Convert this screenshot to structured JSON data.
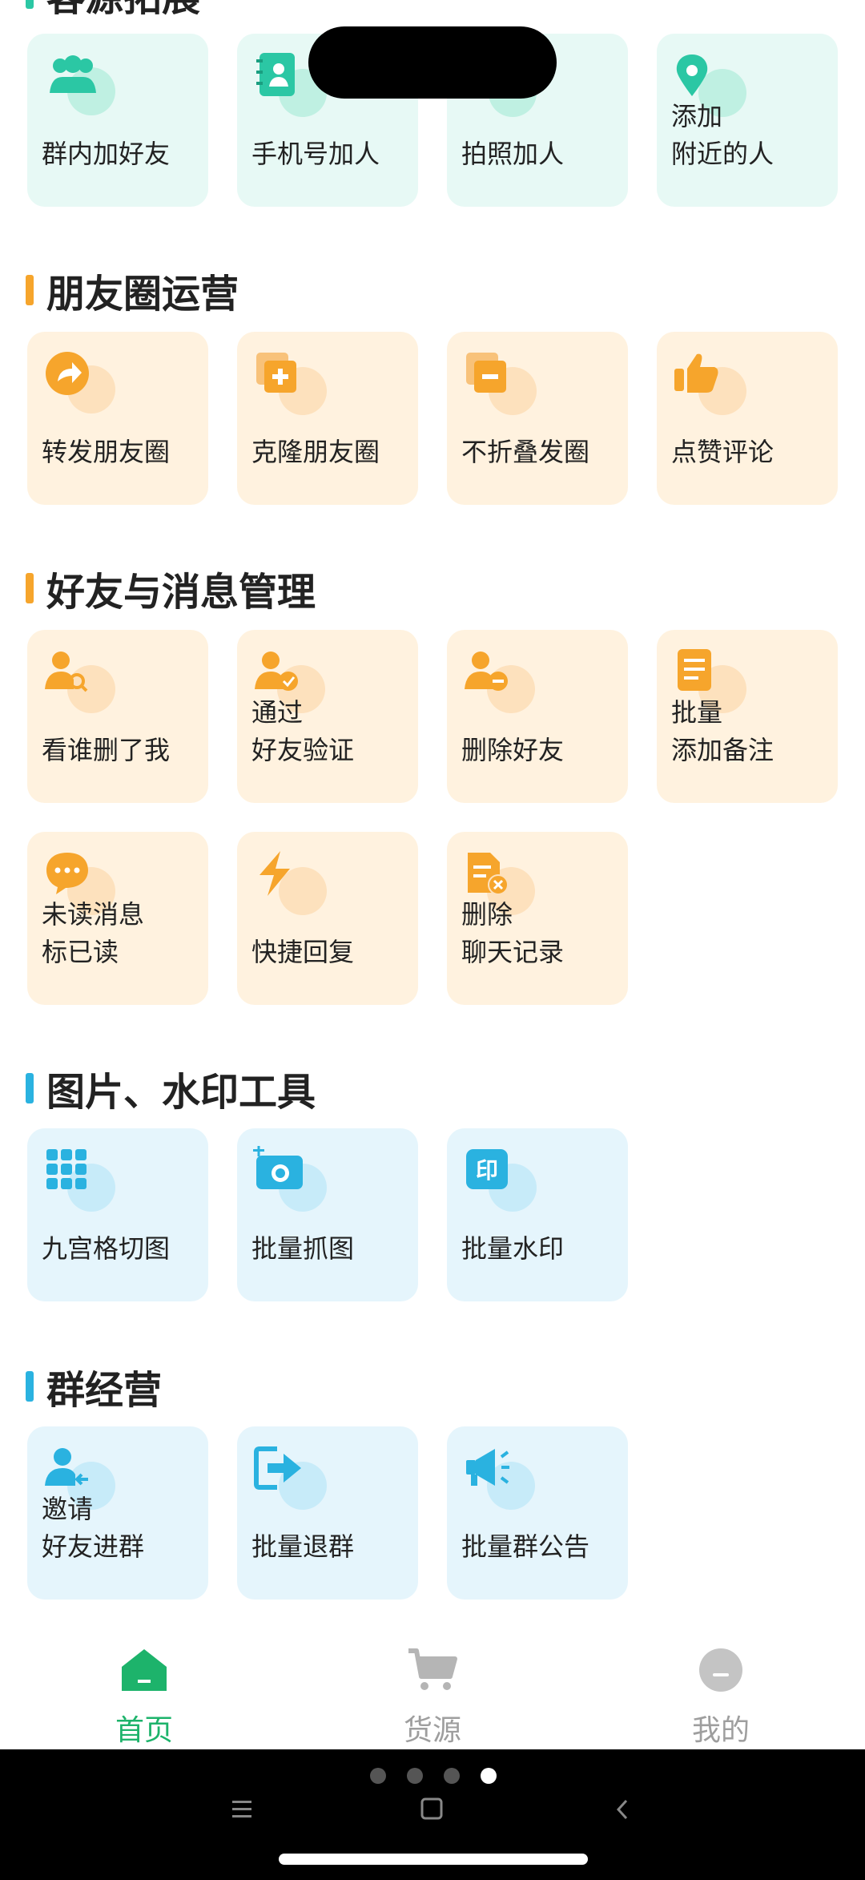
{
  "sections": {
    "s1": {
      "title": "客源拓展",
      "items": [
        {
          "line1": "群内加好友",
          "line2": ""
        },
        {
          "line1": "手机号加人",
          "line2": ""
        },
        {
          "line1": "拍照加人",
          "line2": ""
        },
        {
          "line1": "添加",
          "line2": "附近的人"
        }
      ]
    },
    "s2": {
      "title": "朋友圈运营",
      "items": [
        {
          "line1": "转发朋友圈",
          "line2": ""
        },
        {
          "line1": "克隆朋友圈",
          "line2": ""
        },
        {
          "line1": "不折叠发圈",
          "line2": ""
        },
        {
          "line1": "点赞评论",
          "line2": ""
        }
      ]
    },
    "s3": {
      "title": "好友与消息管理",
      "items": [
        {
          "line1": "看谁删了我",
          "line2": ""
        },
        {
          "line1": "通过",
          "line2": "好友验证"
        },
        {
          "line1": "删除好友",
          "line2": ""
        },
        {
          "line1": "批量",
          "line2": "添加备注"
        },
        {
          "line1": "未读消息",
          "line2": "标已读"
        },
        {
          "line1": "快捷回复",
          "line2": ""
        },
        {
          "line1": "删除",
          "line2": "聊天记录"
        }
      ]
    },
    "s4": {
      "title": "图片、水印工具",
      "items": [
        {
          "line1": "九宫格切图",
          "line2": ""
        },
        {
          "line1": "批量抓图",
          "line2": ""
        },
        {
          "line1": "批量水印",
          "line2": ""
        }
      ]
    },
    "s5": {
      "title": "群经营",
      "items": [
        {
          "line1": "邀请",
          "line2": "好友进群"
        },
        {
          "line1": "批量退群",
          "line2": ""
        },
        {
          "line1": "批量群公告",
          "line2": ""
        }
      ]
    }
  },
  "tabs": [
    {
      "label": "首页",
      "icon": "home-icon",
      "active": true
    },
    {
      "label": "货源",
      "icon": "cart-icon",
      "active": false
    },
    {
      "label": "我的",
      "icon": "profile-icon",
      "active": false
    }
  ],
  "colors": {
    "green_accent": "#2bc7a4",
    "orange_accent": "#f6a52c",
    "blue_accent": "#2ab2e0",
    "tab_active": "#1db36b",
    "tab_inactive": "#9e9e9e"
  },
  "icons": {
    "watermark_glyph": "印"
  }
}
